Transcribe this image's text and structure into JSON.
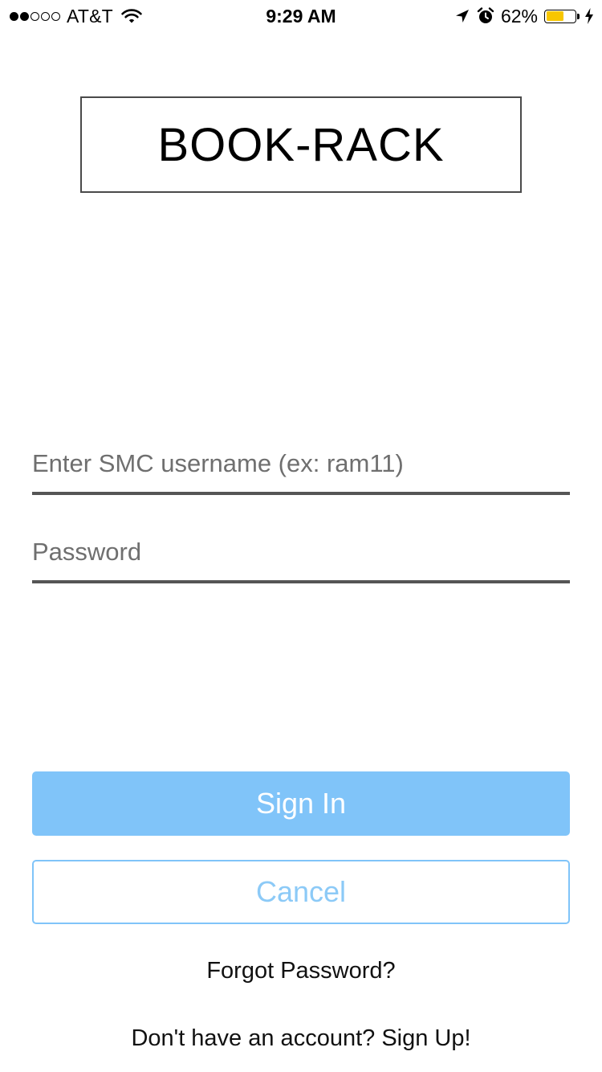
{
  "status_bar": {
    "signal_bars_filled": 2,
    "signal_bars_total": 5,
    "carrier": "AT&T",
    "time": "9:29 AM",
    "battery_percent_label": "62%",
    "battery_level": 0.62,
    "battery_color": "#f7c600",
    "icons": [
      "wifi-icon",
      "location-arrow-icon",
      "alarm-clock-icon",
      "battery-icon",
      "charging-bolt-icon"
    ]
  },
  "logo": {
    "text": "BOOK-RACK"
  },
  "form": {
    "username_placeholder": "Enter SMC username (ex: ram11)",
    "username_value": "",
    "password_placeholder": "Password",
    "password_value": ""
  },
  "buttons": {
    "sign_in": "Sign In",
    "cancel": "Cancel"
  },
  "links": {
    "forgot_password": "Forgot Password?",
    "sign_up": "Don't have an account? Sign Up!"
  },
  "colors": {
    "primary": "#80c4f9",
    "cancel_text": "#8ccaf7",
    "underline": "#555555"
  }
}
